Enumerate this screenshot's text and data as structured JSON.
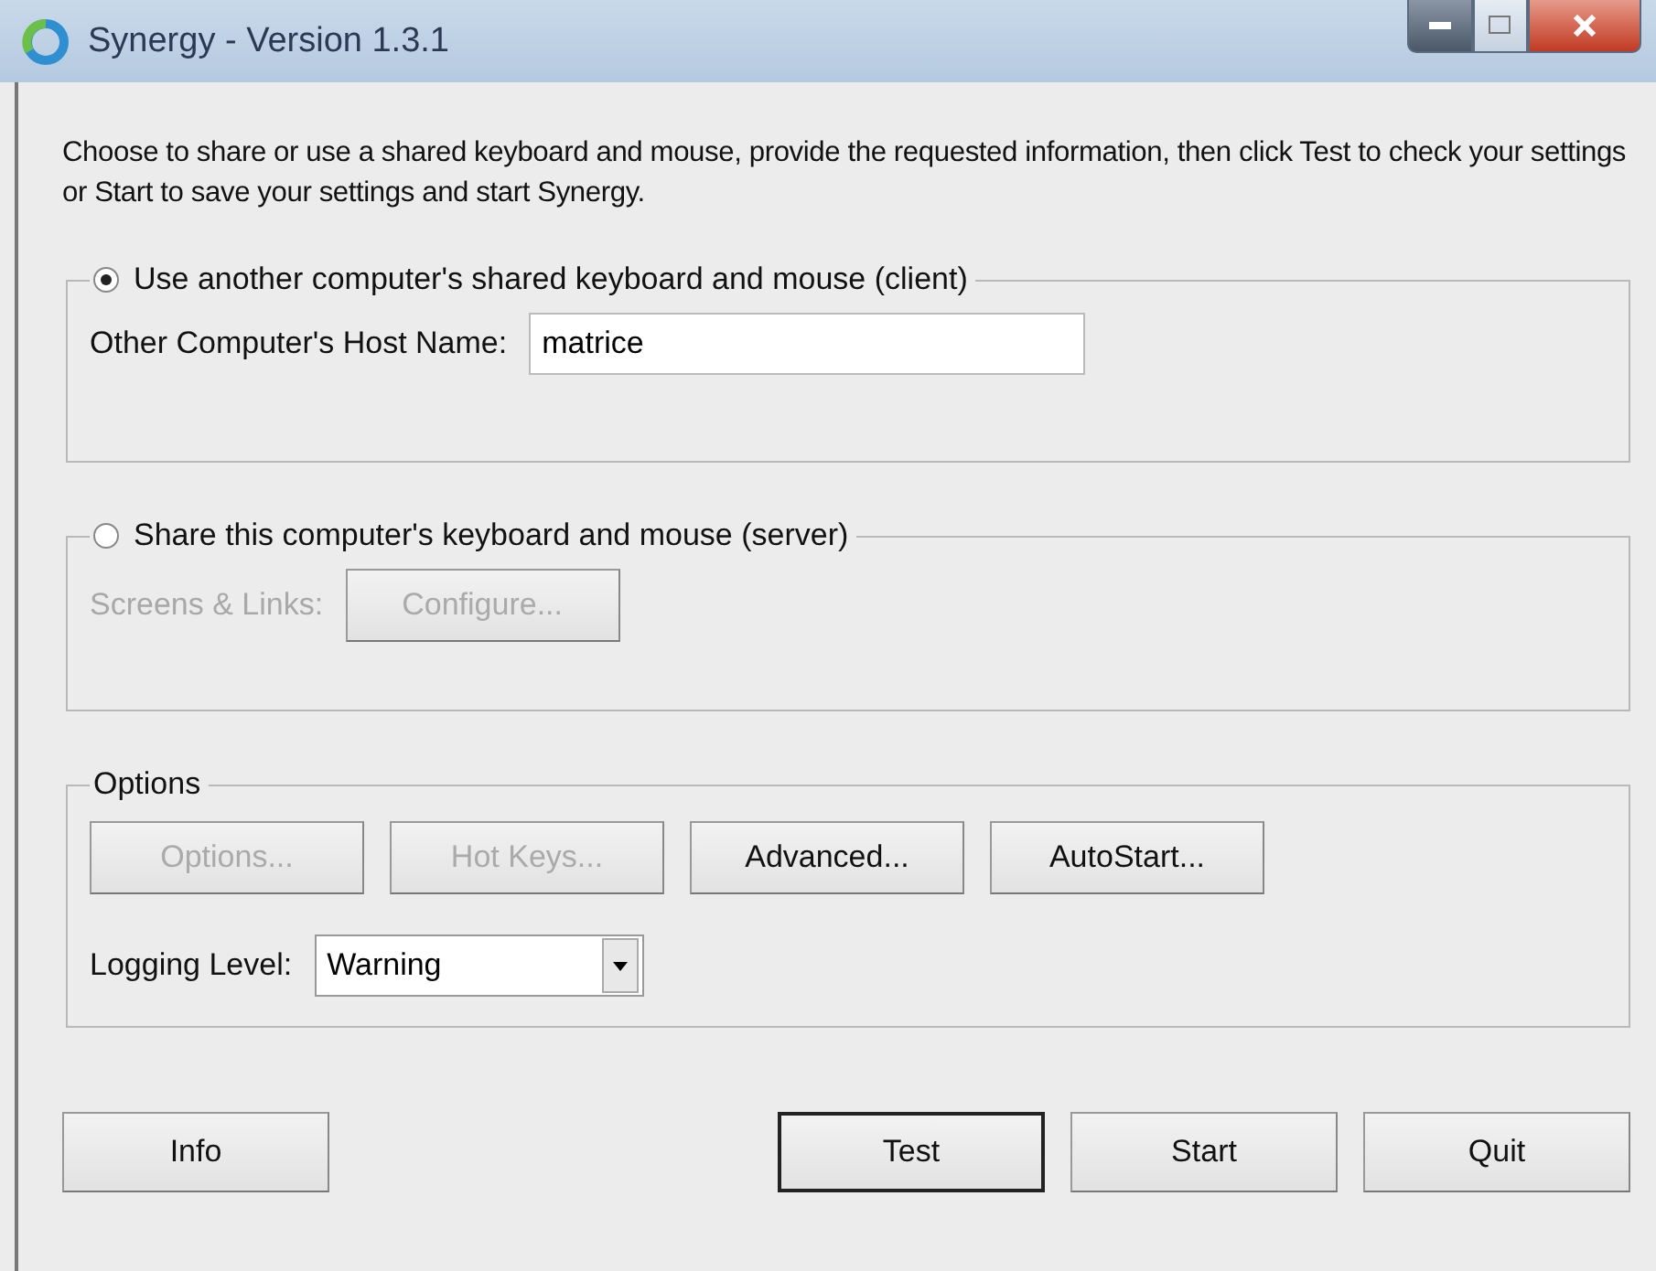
{
  "window": {
    "title": "Synergy - Version 1.3.1"
  },
  "intro": "Choose to share or use a shared keyboard and mouse, provide the requested information, then click Test to check your settings or Start to save your settings and start Synergy.",
  "client": {
    "label": "Use another computer's shared keyboard and mouse (client)",
    "selected": true,
    "host_label": "Other Computer's Host Name:",
    "host_value": "matrice"
  },
  "server": {
    "label": "Share this computer's keyboard and mouse (server)",
    "selected": false,
    "screens_label": "Screens & Links:",
    "configure": {
      "label": "Configure...",
      "disabled": true
    }
  },
  "options": {
    "title": "Options",
    "buttons": [
      {
        "label": "Options...",
        "disabled": true
      },
      {
        "label": "Hot Keys...",
        "disabled": true
      },
      {
        "label": "Advanced...",
        "disabled": false
      },
      {
        "label": "AutoStart...",
        "disabled": false
      }
    ],
    "logging_label": "Logging Level:",
    "logging_value": "Warning"
  },
  "info_button": "Info",
  "buttons": [
    {
      "label": "Test",
      "default": true
    },
    {
      "label": "Start",
      "default": false
    },
    {
      "label": "Quit",
      "default": false
    }
  ]
}
